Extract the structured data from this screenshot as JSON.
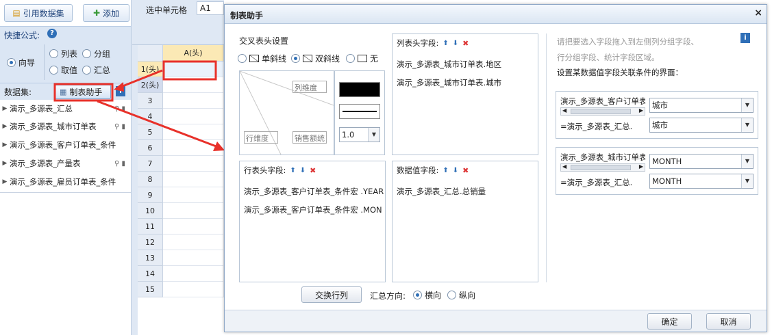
{
  "left": {
    "ref_dataset_label": "引用数据集",
    "add_label": "添加",
    "quick_formula_label": "快捷公式:",
    "options": [
      "向导",
      "列表",
      "分组",
      "取值",
      "汇总"
    ],
    "dataset_label": "数据集:",
    "table_helper_label": "制表助手",
    "datasets": [
      "演示_多源表_汇总",
      "演示_多源表_城市订单表",
      "演示_多源表_客户订单表_条件",
      "演示_多源表_产量表",
      "演示_多源表_雇员订单表_条件"
    ]
  },
  "sheet": {
    "selected_cell_label": "选中单元格",
    "cell_ref": "A1",
    "col_header": "A(头)",
    "rows": [
      "1(头)",
      "2(头)",
      "3",
      "4",
      "5",
      "6",
      "7",
      "8",
      "9",
      "10",
      "11",
      "12",
      "13",
      "14",
      "15"
    ]
  },
  "dialog": {
    "title": "制表助手",
    "close": "×",
    "cross_header_label": "交叉表头设置",
    "header_options": [
      "单斜线",
      "双斜线",
      "无"
    ],
    "col_dim_label": "列维度",
    "row_dim_label": "行维度",
    "sales_label": "销售额统",
    "line_width": "1.0",
    "col_fields_title": "列表头字段:",
    "col_fields": [
      "演示_多源表_城市订单表.地区",
      "演示_多源表_城市订单表.城市"
    ],
    "row_fields_title": "行表头字段:",
    "row_fields": [
      "演示_多源表_客户订单表_条件宏 .YEAR",
      "演示_多源表_客户订单表_条件宏 .MON"
    ],
    "value_fields_title": "数据值字段:",
    "value_fields": [
      "演示_多源表_汇总.总销量"
    ],
    "hint_line1": "请把要选入字段拖入到左侧列分组字段、",
    "hint_line2": "行分组字段、统计字段区域。",
    "relation_title": "设置某数据值字段关联条件的界面：",
    "rel1": {
      "left_top": "演示_多源表_客户订单表",
      "left_bottom": "=演示_多源表_汇总.",
      "val_top": "城市",
      "val_bottom": "城市"
    },
    "rel2": {
      "left_top": "演示_多源表_城市订单表",
      "left_bottom": "=演示_多源表_汇总.",
      "val_top": "MONTH",
      "val_bottom": "MONTH"
    },
    "swap_button": "交换行列",
    "summary_dir_label": "汇总方向:",
    "summary_options": [
      "横向",
      "纵向"
    ],
    "ok": "确定",
    "cancel": "取消"
  },
  "colors": {
    "accent": "#2f6fb7",
    "arrow": "#e8312a",
    "panel_bg": "#dbe6f4"
  }
}
